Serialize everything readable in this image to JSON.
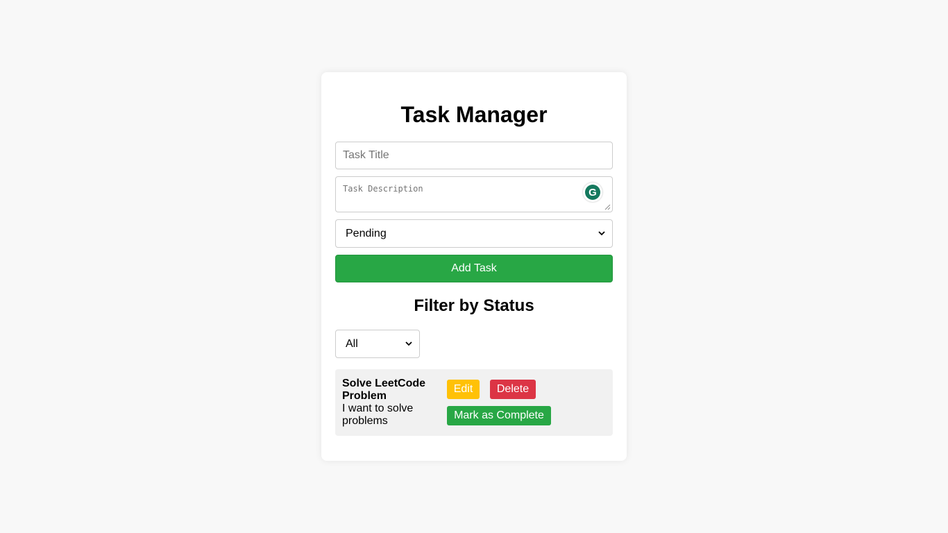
{
  "app": {
    "title": "Task Manager"
  },
  "form": {
    "title_placeholder": "Task Title",
    "title_value": "",
    "description_placeholder": "Task Description",
    "description_value": "",
    "status_selected": "Pending",
    "add_button_label": "Add Task",
    "extension_icon": "grammarly-icon",
    "extension_letter": "G"
  },
  "filter": {
    "heading": "Filter by Status",
    "selected": "All"
  },
  "tasks": [
    {
      "title": "Solve LeetCode Problem",
      "description": "I want to solve problems",
      "edit_label": "Edit",
      "delete_label": "Delete",
      "complete_label": "Mark as Complete"
    }
  ],
  "colors": {
    "primary_green": "#28a745",
    "edit_yellow": "#ffc107",
    "delete_red": "#dc3545",
    "grammarly_green": "#15795e"
  }
}
